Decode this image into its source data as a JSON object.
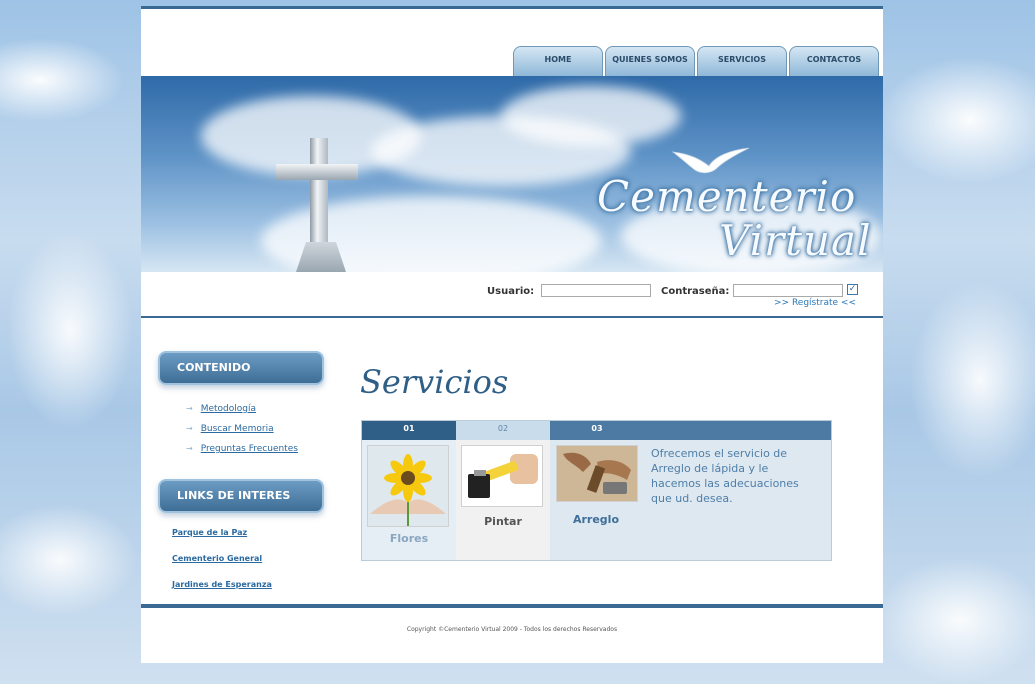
{
  "nav": {
    "tabs": [
      "HOME",
      "QUIENES SOMOS",
      "SERVICIOS",
      "CONTACTOS"
    ]
  },
  "banner": {
    "logo_line1": "Cementerio",
    "logo_line2": "Virtual"
  },
  "login": {
    "usuario_label": "Usuario:",
    "usuario_value": "",
    "password_label": "Contraseña:",
    "password_value": "",
    "submit_icon": "check-icon",
    "register_link": ">> Regístrate <<"
  },
  "sidebar": {
    "contenido_title": "CONTENIDO",
    "contenido_items": [
      "Metodología",
      "Buscar Memoria",
      "Preguntas Frecuentes"
    ],
    "links_title": "LINKS DE INTERES",
    "links_items": [
      "Parque de la Paz",
      "Cementerio General",
      "Jardines de Esperanza"
    ]
  },
  "main": {
    "title": "Servicios",
    "tabs": [
      "01",
      "02",
      "03"
    ],
    "items": [
      {
        "caption": "Flores",
        "icon": "flower-image"
      },
      {
        "caption": "Pintar",
        "icon": "paintbrush-image"
      },
      {
        "caption": "Arreglo",
        "icon": "hammer-image"
      }
    ],
    "description": "Ofrecemos el servicio de Arreglo de lápida y le hacemos las adecuaciones que ud. desea."
  },
  "colors": {
    "accent": "#3a6a93",
    "link": "#2b6aa0",
    "tab_active": "#2f5e86"
  },
  "footer": {
    "copyright": "Copyright ©Cementerio Virtual 2009 - Todos los derechos Reservados"
  }
}
